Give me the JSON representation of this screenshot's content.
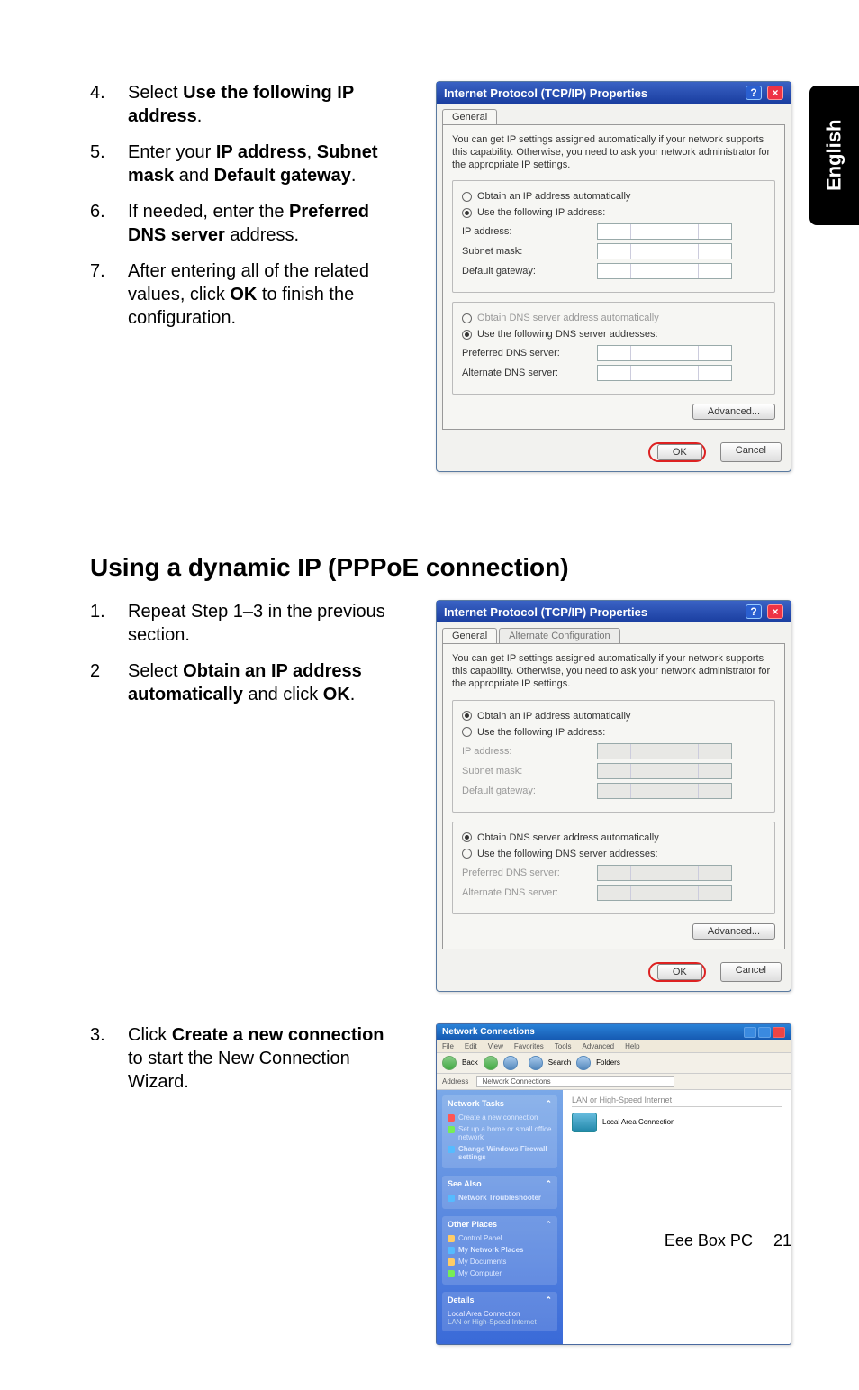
{
  "lang_tab": "English",
  "steps_a": [
    {
      "n": "4.",
      "pre": "Select ",
      "bold": "Use the following IP address",
      "post": "."
    },
    {
      "n": "5.",
      "pre": "Enter your ",
      "bold": "IP address",
      "mid": ", ",
      "bold2": "Subnet mask",
      "mid2": " and ",
      "bold3": "Default gateway",
      "post": "."
    },
    {
      "n": "6.",
      "pre": "If needed, enter the ",
      "bold": "Preferred DNS server",
      "post": " address."
    },
    {
      "n": "7.",
      "pre": "After entering all of the related values, click ",
      "bold": "OK",
      "post": " to finish the configuration."
    }
  ],
  "section_heading": "Using a dynamic IP (PPPoE connection)",
  "steps_b": [
    {
      "n": "1.",
      "text": "Repeat Step 1–3 in the previous section."
    },
    {
      "n": "2",
      "pre": "Select ",
      "bold": "Obtain an IP address automatically",
      "mid": " and click ",
      "bold2": "OK",
      "post": "."
    }
  ],
  "steps_c": [
    {
      "n": "3.",
      "pre": "Click ",
      "bold": "Create a new connection",
      "post": " to start the New Connection Wizard."
    }
  ],
  "dialog": {
    "title": "Internet Protocol (TCP/IP) Properties",
    "tab_general": "General",
    "tab_alt": "Alternate Configuration",
    "intro": "You can get IP settings assigned automatically if your network supports this capability. Otherwise, you need to ask your network administrator for the appropriate IP settings.",
    "opt_auto_ip": "Obtain an IP address automatically",
    "opt_use_ip": "Use the following IP address:",
    "lbl_ip": "IP address:",
    "lbl_subnet": "Subnet mask:",
    "lbl_gateway": "Default gateway:",
    "opt_auto_dns": "Obtain DNS server address automatically",
    "opt_use_dns": "Use the following DNS server addresses:",
    "lbl_pref_dns": "Preferred DNS server:",
    "lbl_alt_dns": "Alternate DNS server:",
    "btn_adv": "Advanced...",
    "btn_ok": "OK",
    "btn_cancel": "Cancel"
  },
  "nc": {
    "title": "Network Connections",
    "menu": [
      "File",
      "Edit",
      "View",
      "Favorites",
      "Tools",
      "Advanced",
      "Help"
    ],
    "toolbar": {
      "back": "Back",
      "search": "Search",
      "folders": "Folders"
    },
    "address_label": "Address",
    "address_value": "Network Connections",
    "side": {
      "tasks_hd": "Network Tasks",
      "tasks": [
        "Create a new connection",
        "Set up a home or small office network",
        "Change Windows Firewall settings"
      ],
      "see_hd": "See Also",
      "see": [
        "Network Troubleshooter"
      ],
      "places_hd": "Other Places",
      "places": [
        "Control Panel",
        "My Network Places",
        "My Documents",
        "My Computer"
      ],
      "details_hd": "Details",
      "details": [
        "Local Area Connection",
        "LAN or High-Speed Internet"
      ]
    },
    "main": {
      "cat": "LAN or High-Speed Internet",
      "item": "Local Area Connection"
    }
  },
  "footer": {
    "product": "Eee Box PC",
    "page": "21"
  }
}
